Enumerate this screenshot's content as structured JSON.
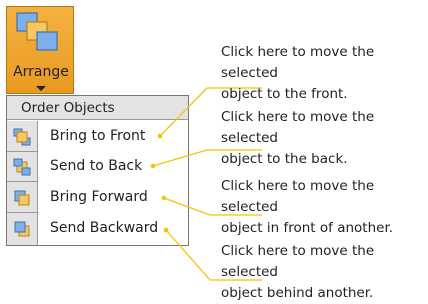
{
  "arrange": {
    "label": "Arrange",
    "icon": "arrange-icon",
    "accent": "#f0a82e"
  },
  "menu": {
    "header": "Order Objects",
    "items": [
      {
        "label": "Bring to Front",
        "icon": "bring-to-front-icon"
      },
      {
        "label": "Send to Back",
        "icon": "send-to-back-icon"
      },
      {
        "label": "Bring Forward",
        "icon": "bring-forward-icon"
      },
      {
        "label": "Send Backward",
        "icon": "send-backward-icon"
      }
    ]
  },
  "callouts": [
    {
      "line1": "Click here to move the selected",
      "line2": "object to the front."
    },
    {
      "line1": "Click here to move the selected",
      "line2": "object to the back."
    },
    {
      "line1": "Click here to move the selected",
      "line2": "object in front of another."
    },
    {
      "line1": "Click here to move the selected",
      "line2": "object behind another."
    }
  ],
  "colors": {
    "leader_line": "#f5c400",
    "icon_blue": "#5b8fd6",
    "icon_orange": "#f5b942"
  }
}
